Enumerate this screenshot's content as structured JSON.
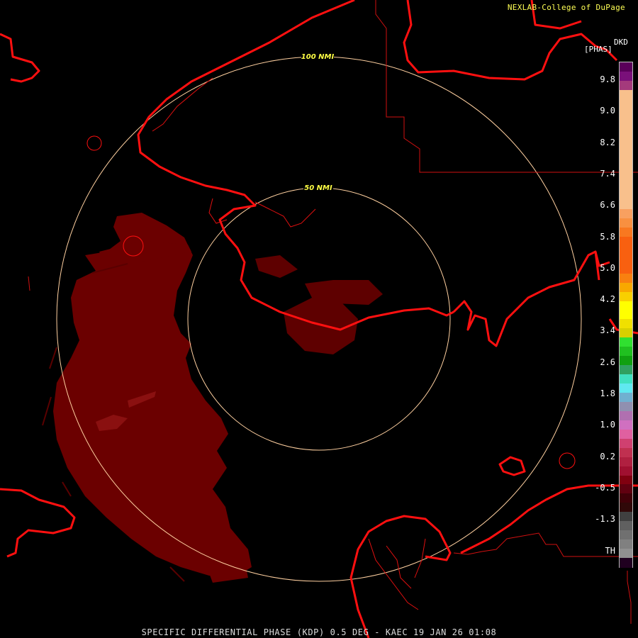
{
  "credit": "NEXLAB-College of DuPage",
  "legend": {
    "product_code": "DKD",
    "units": "[PHAS]",
    "ticks": [
      "9.8",
      "9.0",
      "8.2",
      "7.4",
      "6.6",
      "5.8",
      "5.0",
      "4.2",
      "3.4",
      "2.6",
      "1.8",
      "1.0",
      "0.2",
      "-0.5",
      "-1.3",
      "TH"
    ],
    "colors": [
      "#5a005a",
      "#7a107a",
      "#a43a7c",
      "#f8c08c",
      "#f8c08c",
      "#f8c08c",
      "#f8c08c",
      "#f8c08c",
      "#f8c08c",
      "#f8c08c",
      "#f8c08c",
      "#f8c08c",
      "#f8c08c",
      "#f8c08c",
      "#f8c08c",
      "#f8c08c",
      "#f8a060",
      "#f89040",
      "#f87820",
      "#f86010",
      "#f86010",
      "#f86010",
      "#f86010",
      "#f88010",
      "#f8a800",
      "#f8d000",
      "#ffff00",
      "#ffff00",
      "#f0e000",
      "#d8d000",
      "#30e030",
      "#20c020",
      "#10a010",
      "#30a060",
      "#40e0c0",
      "#60e8f0",
      "#70b0d0",
      "#9090b0",
      "#b070b0",
      "#d070c0",
      "#e060a0",
      "#d04070",
      "#c03050",
      "#b02040",
      "#a01030",
      "#800010",
      "#600010",
      "#400008",
      "#300808",
      "#404040",
      "#606060",
      "#707070",
      "#808080",
      "#909090",
      "#200020"
    ]
  },
  "range_rings": [
    "100 NMI",
    "50 NMI"
  ],
  "footer": "SPECIFIC DIFFERENTIAL PHASE (KDP) 0.5 DEG - KAEC 19 JAN 26 01:08",
  "map_colors": {
    "boundaries": "#ff1010",
    "rings": "#ffd0a0",
    "echo": "#6b0000"
  }
}
